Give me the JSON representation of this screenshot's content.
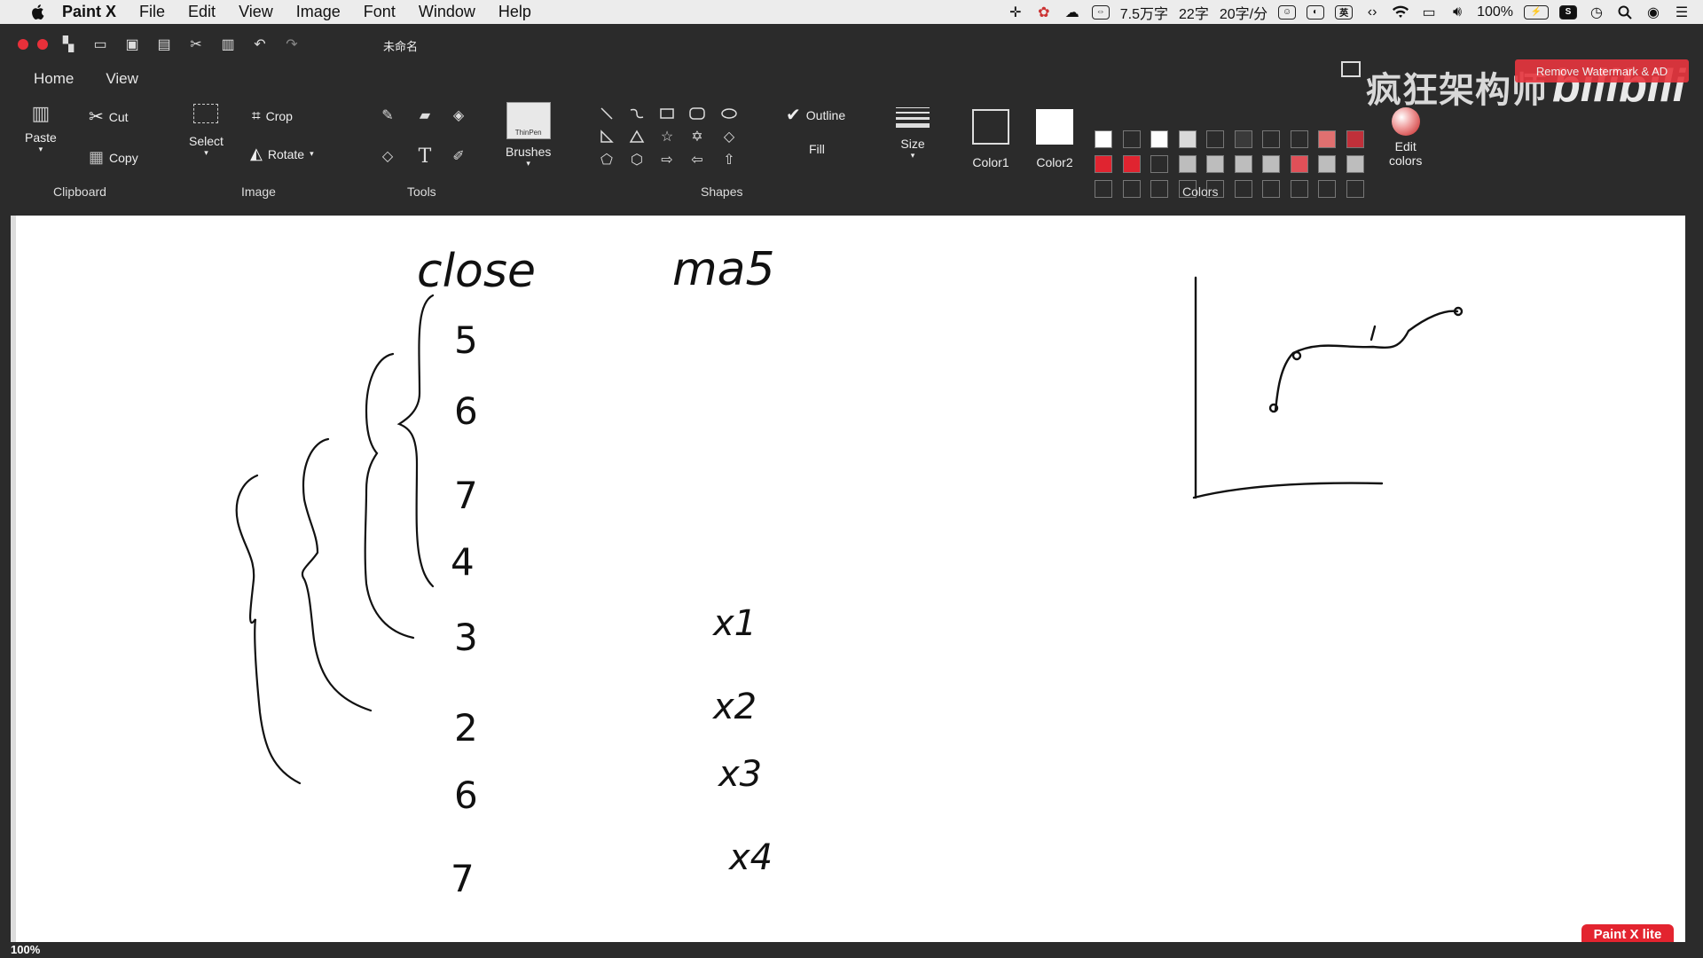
{
  "menubar": {
    "app_name": "Paint X",
    "menus": [
      "File",
      "Edit",
      "View",
      "Image",
      "Font",
      "Window",
      "Help"
    ],
    "status": {
      "word_count": "7.5万字",
      "chars": "22字",
      "rate": "20字/分",
      "battery": "100%"
    }
  },
  "document": {
    "title": "未命名"
  },
  "tabs": [
    "Home",
    "View"
  ],
  "ribbon": {
    "clipboard": {
      "label": "Clipboard",
      "paste": "Paste",
      "cut": "Cut",
      "copy": "Copy"
    },
    "image": {
      "label": "Image",
      "select": "Select",
      "crop": "Crop",
      "rotate": "Rotate"
    },
    "tools": {
      "label": "Tools"
    },
    "brushes": {
      "label": "Brushes",
      "preview": "ThinPen"
    },
    "shapes": {
      "label": "Shapes",
      "outline": "Outline",
      "fill": "Fill"
    },
    "size": {
      "label": "Size"
    },
    "colors": {
      "label": "Colors",
      "color1": "Color1",
      "color2": "Color2",
      "edit_line1": "Edit",
      "edit_line2": "colors"
    }
  },
  "palette": {
    "row1": [
      "#ffffff",
      "#2b2b2b",
      "#ffffff",
      "#d9d9d9",
      "#2b2b2b",
      "#3a3a3a",
      "#2b2b2b",
      "#2b2b2b",
      "#e07070",
      "#c0303a"
    ],
    "row2": [
      "#e02430",
      "#e02430",
      "#2b2b2b",
      "#bdbdbd",
      "#bdbdbd",
      "#bdbdbd",
      "#bdbdbd",
      "#e05058",
      "#bdbdbd",
      "#bdbdbd"
    ],
    "row3": [
      "#2b2b2b",
      "#2b2b2b",
      "#2b2b2b",
      "#2b2b2b",
      "#2b2b2b",
      "#2b2b2b",
      "#2b2b2b",
      "#2b2b2b",
      "#2b2b2b",
      "#2b2b2b"
    ]
  },
  "watermark": {
    "chinese": "疯狂架构师",
    "bili": "bilibili",
    "remove": "Remove Watermark & AD"
  },
  "canvas": {
    "heading_close": "close",
    "heading_ma": "ma5",
    "close_values": [
      "5",
      "6",
      "7",
      "4",
      "3",
      "2",
      "6",
      "7"
    ],
    "x_labels": [
      "x1",
      "x2",
      "x3",
      "x4"
    ]
  },
  "status": {
    "zoom": "100%",
    "lite_badge": "Paint X lite"
  }
}
